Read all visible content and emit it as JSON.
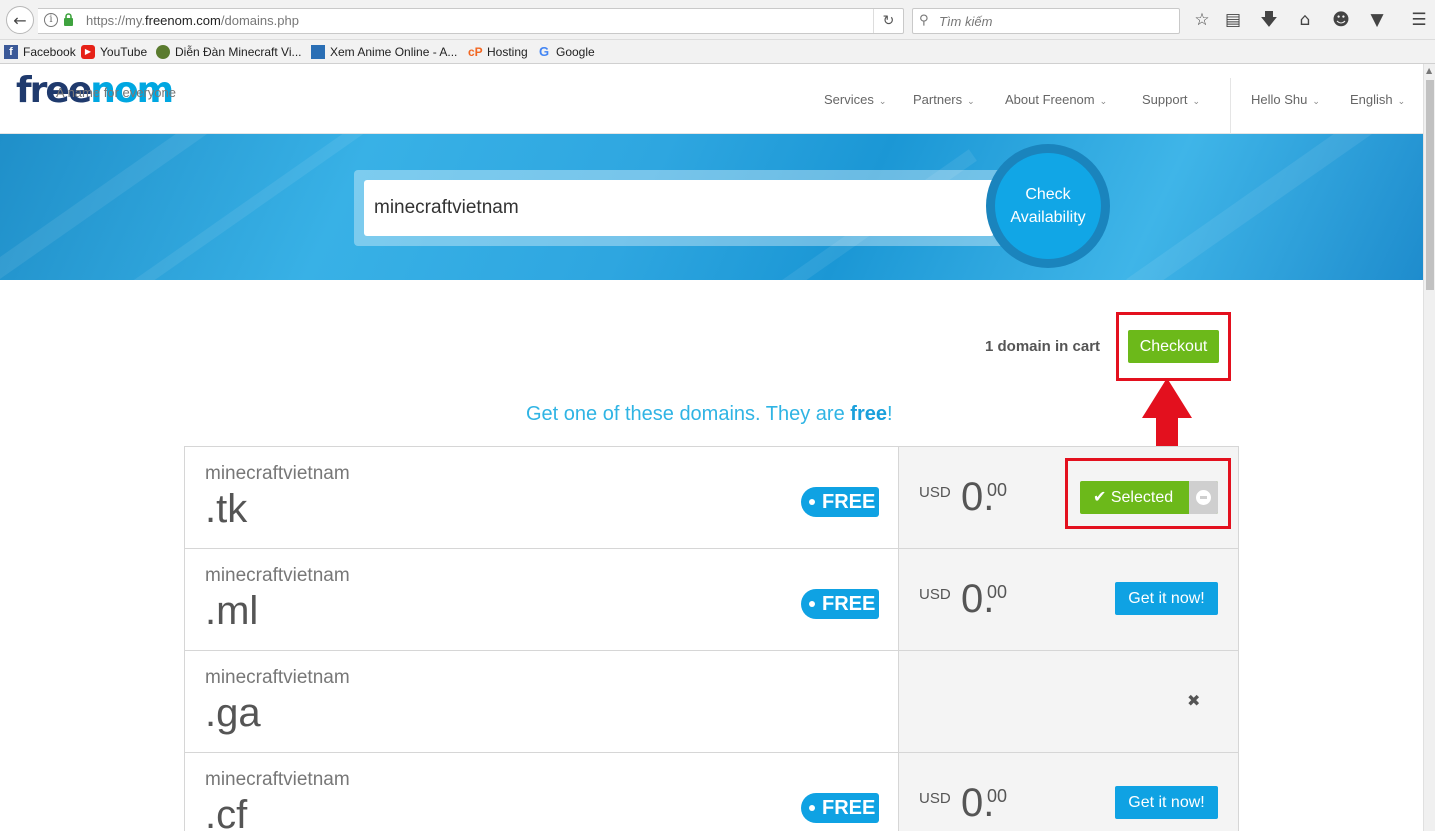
{
  "browser": {
    "url_prefix": "https://my.",
    "url_domain": "freenom.com",
    "url_suffix": "/domains.php",
    "search_placeholder": "Tìm kiếm"
  },
  "bookmarks": [
    {
      "label": "Facebook",
      "icon": "facebook-icon",
      "color": "#3b5998"
    },
    {
      "label": "YouTube",
      "icon": "youtube-icon",
      "color": "#e62117"
    },
    {
      "label": "Diễn Đàn Minecraft Vi...",
      "icon": "minecraft-icon",
      "color": "#5a7b2e"
    },
    {
      "label": "Xem Anime Online - A...",
      "icon": "anime-icon",
      "color": "#2a6fb5"
    },
    {
      "label": "Hosting",
      "icon": "cpanel-icon",
      "color": "#f26722"
    },
    {
      "label": "Google",
      "icon": "google-icon",
      "color": "#4285f4"
    }
  ],
  "site": {
    "logo_a": "free",
    "logo_b": "nom",
    "tagline": "A name for everyone",
    "nav": [
      "Services",
      "Partners",
      "About Freenom",
      "Support"
    ],
    "user": "Hello Shu",
    "language": "English"
  },
  "search": {
    "value": "minecraftvietnam",
    "button_line1": "Check",
    "button_line2": "Availability"
  },
  "cart": {
    "text": "1 domain in cart",
    "checkout_label": "Checkout"
  },
  "heading": {
    "text": "Get one of these domains. They are ",
    "bold": "free",
    "end": "!"
  },
  "domains": [
    {
      "name": "minecraftvietnam",
      "tld": ".tk",
      "badge": "FREE",
      "currency": "USD",
      "price_int": "0.",
      "price_dec": "00",
      "action": "Selected",
      "state": "selected"
    },
    {
      "name": "minecraftvietnam",
      "tld": ".ml",
      "badge": "FREE",
      "currency": "USD",
      "price_int": "0.",
      "price_dec": "00",
      "action": "Get it now!",
      "state": "available"
    },
    {
      "name": "minecraftvietnam",
      "tld": ".ga",
      "badge": "",
      "currency": "",
      "price_int": "",
      "price_dec": "",
      "action": "",
      "state": "unavailable"
    },
    {
      "name": "minecraftvietnam",
      "tld": ".cf",
      "badge": "FREE",
      "currency": "USD",
      "price_int": "0.",
      "price_dec": "00",
      "action": "Get it now!",
      "state": "available"
    }
  ],
  "colors": {
    "accent_blue": "#0fa2e3",
    "accent_green": "#6cb91a",
    "highlight_red": "#e3101e"
  }
}
